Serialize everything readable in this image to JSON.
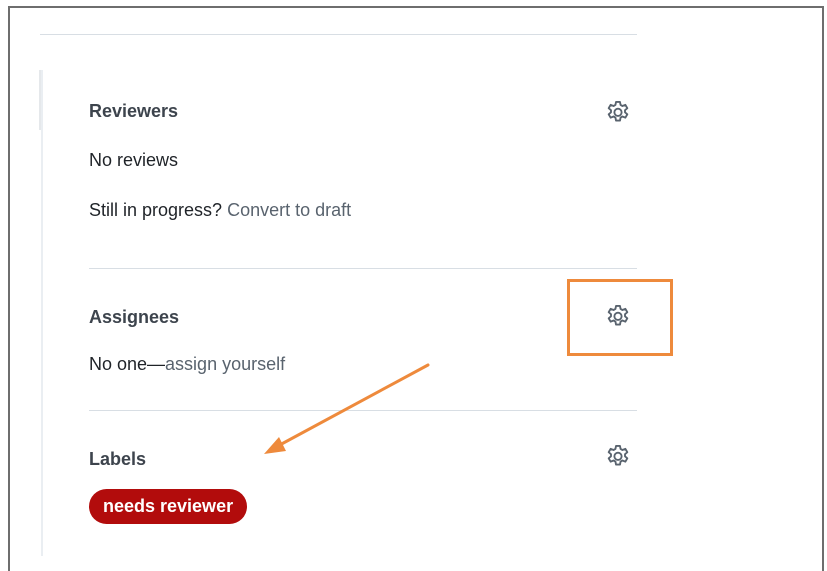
{
  "sidebar": {
    "reviewers": {
      "title": "Reviewers",
      "status": "No reviews",
      "draft_prompt": "Still in progress?",
      "draft_link": "Convert to draft",
      "settings_icon": "gear-icon"
    },
    "assignees": {
      "title": "Assignees",
      "empty_text": "No one—",
      "assign_link": "assign yourself",
      "settings_icon": "gear-icon"
    },
    "labels": {
      "title": "Labels",
      "items": [
        {
          "name": "needs reviewer",
          "color": "#b20c0c"
        }
      ],
      "settings_icon": "gear-icon"
    }
  },
  "annotations": {
    "highlight_color": "#ee8a3c",
    "arrow_color": "#ee8a3c"
  }
}
